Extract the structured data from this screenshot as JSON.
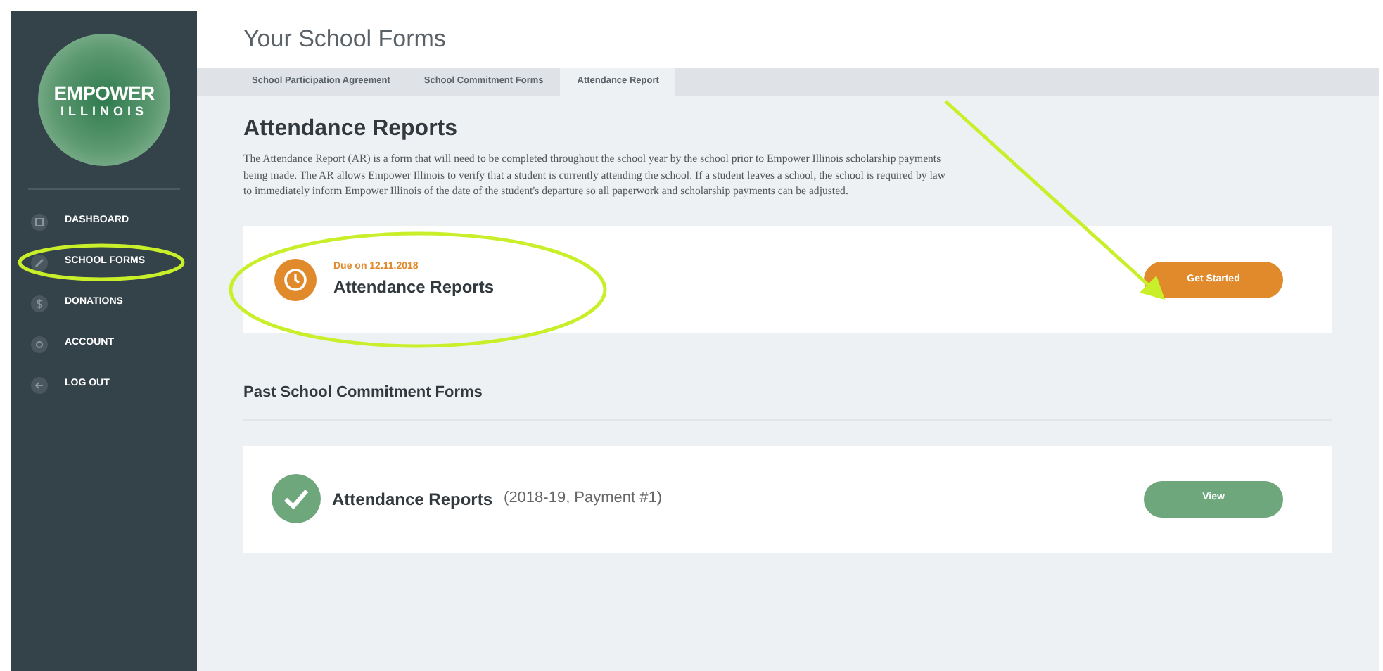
{
  "logo": {
    "line1": "EMPOWER",
    "line2": "ILLINOIS"
  },
  "sidebar": {
    "items": [
      {
        "label": "DASHBOARD",
        "kind": "dashboard",
        "circled": false
      },
      {
        "label": "SCHOOL FORMS",
        "kind": "forms",
        "circled": true
      },
      {
        "label": "DONATIONS",
        "kind": "donations",
        "circled": false
      },
      {
        "label": "ACCOUNT",
        "kind": "account",
        "circled": false
      },
      {
        "label": "LOG OUT",
        "kind": "logout",
        "circled": false
      }
    ]
  },
  "header": {
    "title": "Your School Forms"
  },
  "tabs": [
    {
      "label": "School Participation Agreement",
      "selected": false
    },
    {
      "label": "School Commitment Forms",
      "selected": false
    },
    {
      "label": "Attendance Report",
      "selected": true
    }
  ],
  "section": {
    "title": "Attendance Reports",
    "description": "The Attendance Report (AR) is a form that will need to be completed throughout the school year by the school prior to Empower Illinois scholarship payments being made. The AR allows Empower Illinois to verify that a student is currently attending the school. If a student leaves a school, the school is required by law to immediately inform Empower Illinois of the date of the student's departure so all paperwork and scholarship payments can be adjusted."
  },
  "due_card": {
    "due": "Due on 12.11.2018",
    "title": "Attendance Reports",
    "button": "Get Started",
    "circled": true,
    "arrow": true
  },
  "past": {
    "title": "Past School Commitment Forms",
    "items": [
      {
        "title": "Attendance Reports",
        "detail": "(2018-19, Payment #1)",
        "button": "View"
      }
    ]
  }
}
